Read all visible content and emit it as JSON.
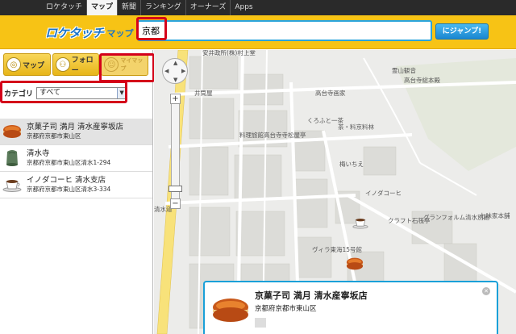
{
  "topnav": {
    "items": [
      {
        "label": "ロケタッチ",
        "active": false
      },
      {
        "label": "マップ",
        "active": true
      },
      {
        "label": "新聞",
        "active": false
      },
      {
        "label": "ランキング",
        "active": false
      },
      {
        "label": "オーナーズ",
        "active": false
      },
      {
        "label": "Apps",
        "active": false
      }
    ]
  },
  "header": {
    "logo_main": "ロケタッチ",
    "logo_sub": "マップ",
    "search_value": "京都",
    "jump_label": "にジャンプ!"
  },
  "tabs": [
    {
      "label": "マップ",
      "icon": "globe-icon"
    },
    {
      "label": "フォロー",
      "icon": "people-icon"
    },
    {
      "label": "マイマップ",
      "icon": "smiley-icon"
    }
  ],
  "category": {
    "label": "カテゴリ",
    "selected": "すべて"
  },
  "results": [
    {
      "name": "京菓子司 満月 清水産寧坂店",
      "address": "京都府京都市東山区",
      "icon": "dorayaki-icon",
      "active": true
    },
    {
      "name": "清水寺",
      "address": "京都府京都市東山区清水1-294",
      "icon": "temple-bell-icon",
      "active": false
    },
    {
      "name": "イノダコーヒ 清水支店",
      "address": "京都府京都市東山区清水3-334",
      "icon": "coffee-cup-icon",
      "active": false
    }
  ],
  "map": {
    "labels": [
      "安井政所(株)村上堂",
      "井筒屋",
      "霊山観音",
      "高台寺総本殿",
      "高台寺画家",
      "くろふと一茶",
      "料理旅館高台寺寺松屋亭",
      "梅いちえ",
      "茶・料京料林",
      "清水道",
      "イノダコーヒ",
      "クラフト石筏亭",
      "グランフォルム清水別館",
      "七味家本舗",
      "ヴィラ東海15号館"
    ]
  },
  "popup": {
    "title": "京菓子司 満月 清水産寧坂店",
    "address": "京都府京都市東山区"
  }
}
